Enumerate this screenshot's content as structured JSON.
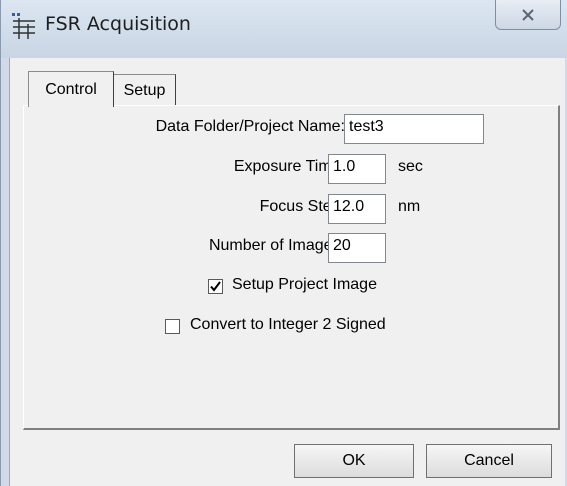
{
  "window": {
    "title": "FSR Acquisition",
    "icon": "fsr-app-icon",
    "close_icon": "close-x-icon"
  },
  "tabs": [
    {
      "label": "Control",
      "selected": true
    },
    {
      "label": "Setup",
      "selected": false
    }
  ],
  "form": {
    "data_folder": {
      "label": "Data Folder/Project Name:",
      "value": "test3"
    },
    "exposure_time": {
      "label": "Exposure Time:",
      "value": "1.0",
      "unit": "sec"
    },
    "focus_step": {
      "label": "Focus Step:",
      "value": "12.0",
      "unit": "nm"
    },
    "number_of_images": {
      "label": "Number of Images:",
      "value": "20"
    },
    "setup_project_image": {
      "label": "Setup Project Image",
      "checked": true
    },
    "convert_integer": {
      "label": "Convert to Integer 2 Signed",
      "checked": false
    }
  },
  "buttons": {
    "ok": "OK",
    "cancel": "Cancel"
  }
}
